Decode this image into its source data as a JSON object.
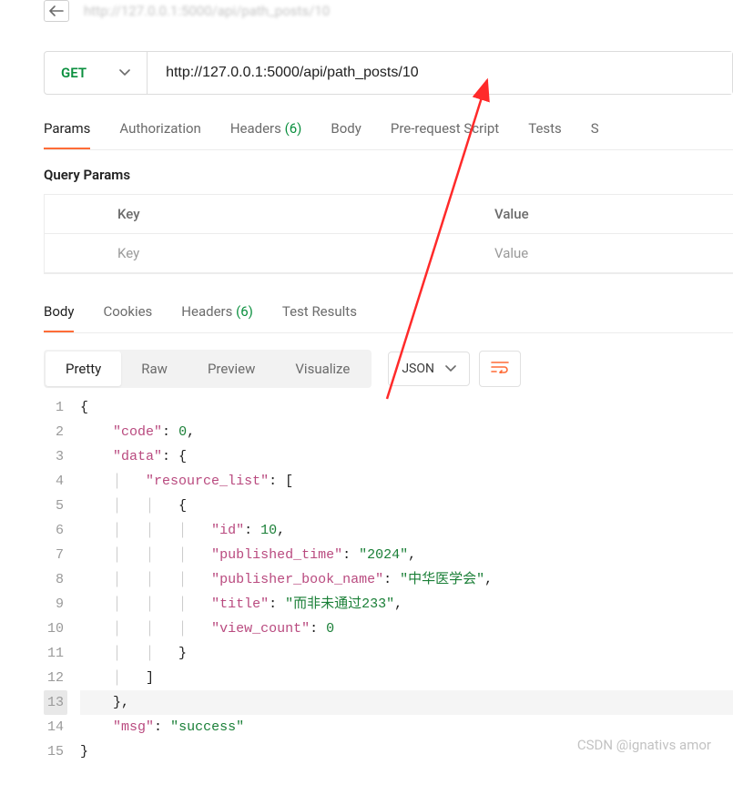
{
  "top": {
    "back_url_partial": "http://127.0.0.1:5000/api/path_posts/10"
  },
  "request": {
    "method": "GET",
    "url": "http://127.0.0.1:5000/api/path_posts/10"
  },
  "reqTabs": {
    "params": "Params",
    "authorization": "Authorization",
    "headers": "Headers",
    "headers_count": "(6)",
    "body": "Body",
    "prerequest": "Pre-request Script",
    "tests": "Tests",
    "settings_s": "S"
  },
  "queryParams": {
    "title": "Query Params",
    "key_header": "Key",
    "value_header": "Value",
    "key_placeholder": "Key",
    "value_placeholder": "Value"
  },
  "respTabs": {
    "body": "Body",
    "cookies": "Cookies",
    "headers": "Headers",
    "headers_count": "(6)",
    "results": "Test Results"
  },
  "format": {
    "pretty": "Pretty",
    "raw": "Raw",
    "preview": "Preview",
    "visualize": "Visualize",
    "type": "JSON"
  },
  "json": {
    "l1": "{",
    "l2a": "\"code\"",
    "l2b": "0",
    "l3a": "\"data\"",
    "l4a": "\"resource_list\"",
    "l6a": "\"id\"",
    "l6b": "10",
    "l7a": "\"published_time\"",
    "l7b": "\"2024\"",
    "l8a": "\"publisher_book_name\"",
    "l8b": "\"中华医学会\"",
    "l9a": "\"title\"",
    "l9b": "\"而非未通过233\"",
    "l10a": "\"view_count\"",
    "l10b": "0",
    "l14a": "\"msg\"",
    "l14b": "\"success\""
  },
  "watermark": "CSDN @ignativs  amor"
}
